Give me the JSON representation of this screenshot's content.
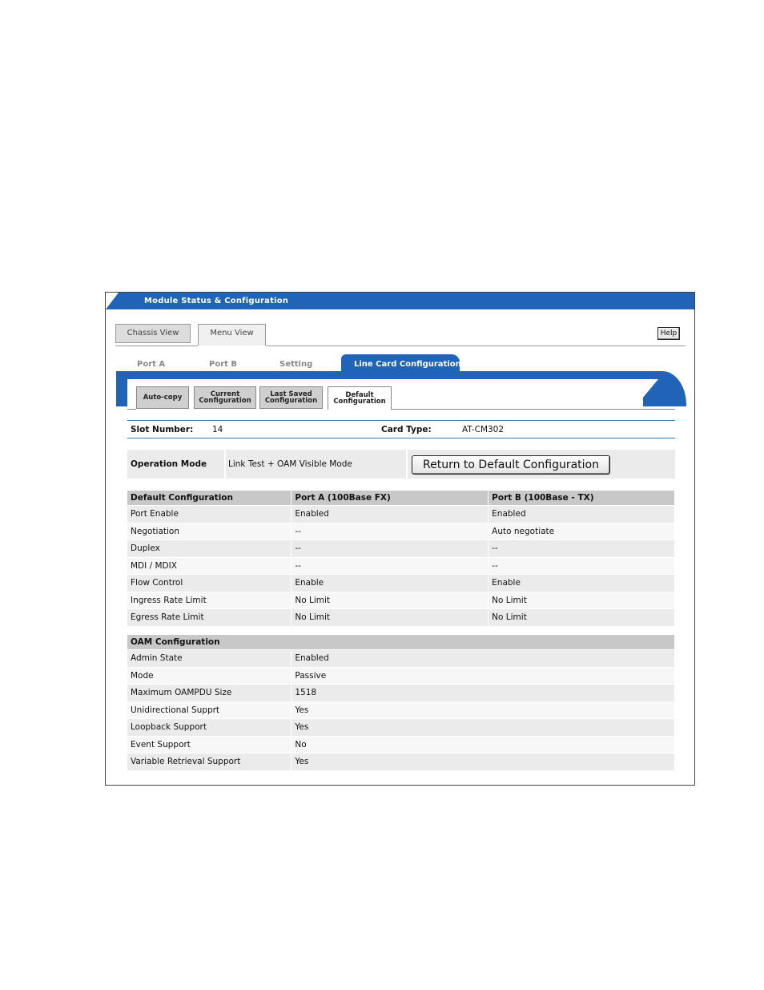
{
  "window": {
    "title": "Module Status & Configuration"
  },
  "views": {
    "chassis": "Chassis View",
    "menu": "Menu View",
    "help": "Help"
  },
  "port_tabs": [
    "Port A",
    "Port B",
    "Setting",
    "Line Card Configuration"
  ],
  "config_buttons": {
    "auto_copy": "Auto-copy",
    "current_1": "Current",
    "current_2": "Configuration",
    "last_1": "Last Saved",
    "last_2": "Configuration",
    "default_1": "Default",
    "default_2": "Configuration"
  },
  "slot": {
    "label": "Slot Number:",
    "value": "14"
  },
  "card": {
    "label": "Card Type:",
    "value": "AT-CM302"
  },
  "operation": {
    "label": "Operation Mode",
    "value": "Link Test + OAM Visible Mode",
    "button": "Return to Default Configuration"
  },
  "default_table": {
    "headers": [
      "Default Configuration",
      "Port A (100Base FX)",
      "Port B (100Base - TX)"
    ],
    "rows": [
      [
        "Port Enable",
        "Enabled",
        "Enabled"
      ],
      [
        "Negotiation",
        "--",
        "Auto negotiate"
      ],
      [
        "Duplex",
        "--",
        "--"
      ],
      [
        "MDI / MDIX",
        "--",
        "--"
      ],
      [
        "Flow Control",
        "Enable",
        "Enable"
      ],
      [
        "Ingress Rate Limit",
        "No Limit",
        "No Limit"
      ],
      [
        "Egress Rate Limit",
        "No Limit",
        "No Limit"
      ]
    ]
  },
  "oam_table": {
    "header": "OAM Configuration",
    "rows": [
      [
        "Admin State",
        "Enabled"
      ],
      [
        "Mode",
        "Passive"
      ],
      [
        "Maximum OAMPDU Size",
        "1518"
      ],
      [
        "Unidirectional Supprt",
        "Yes"
      ],
      [
        "Loopback Support",
        "Yes"
      ],
      [
        "Event Support",
        "No"
      ],
      [
        "Variable Retrieval Support",
        "Yes"
      ]
    ]
  },
  "colors": {
    "accent_blue": "#1f64b8",
    "header_gray": "#c8c8c8",
    "row_gray": "#ebebeb"
  }
}
